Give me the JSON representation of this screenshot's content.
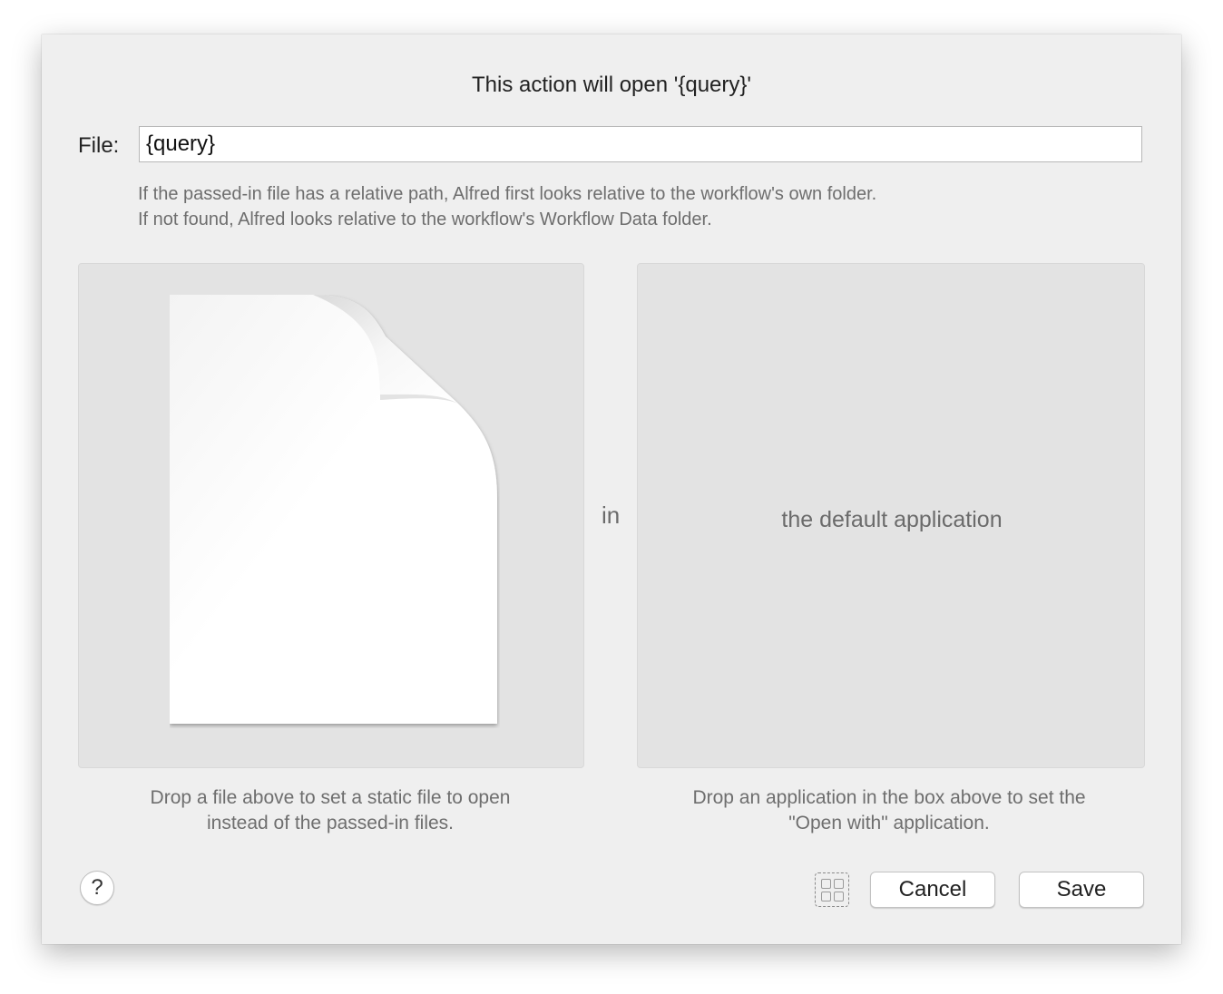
{
  "dialog": {
    "title": "This action will open '{query}'"
  },
  "file_field": {
    "label": "File:",
    "value": "{query}"
  },
  "hint": {
    "line1": "If the passed-in file has a relative path, Alfred first looks relative to the workflow's own folder.",
    "line2": "If not found, Alfred looks relative to the workflow's Workflow Data folder."
  },
  "file_drop": {
    "icon": "document-icon",
    "caption_line1": "Drop a file above to set a static file to open",
    "caption_line2": "instead of the passed-in files."
  },
  "connector": {
    "label": "in"
  },
  "app_drop": {
    "label": "the default application",
    "caption_line1": "Drop an application in the box above to set the",
    "caption_line2": "\"Open with\" application."
  },
  "footer": {
    "help_label": "?",
    "grid_icon": "grid-icon",
    "cancel_label": "Cancel",
    "save_label": "Save"
  }
}
